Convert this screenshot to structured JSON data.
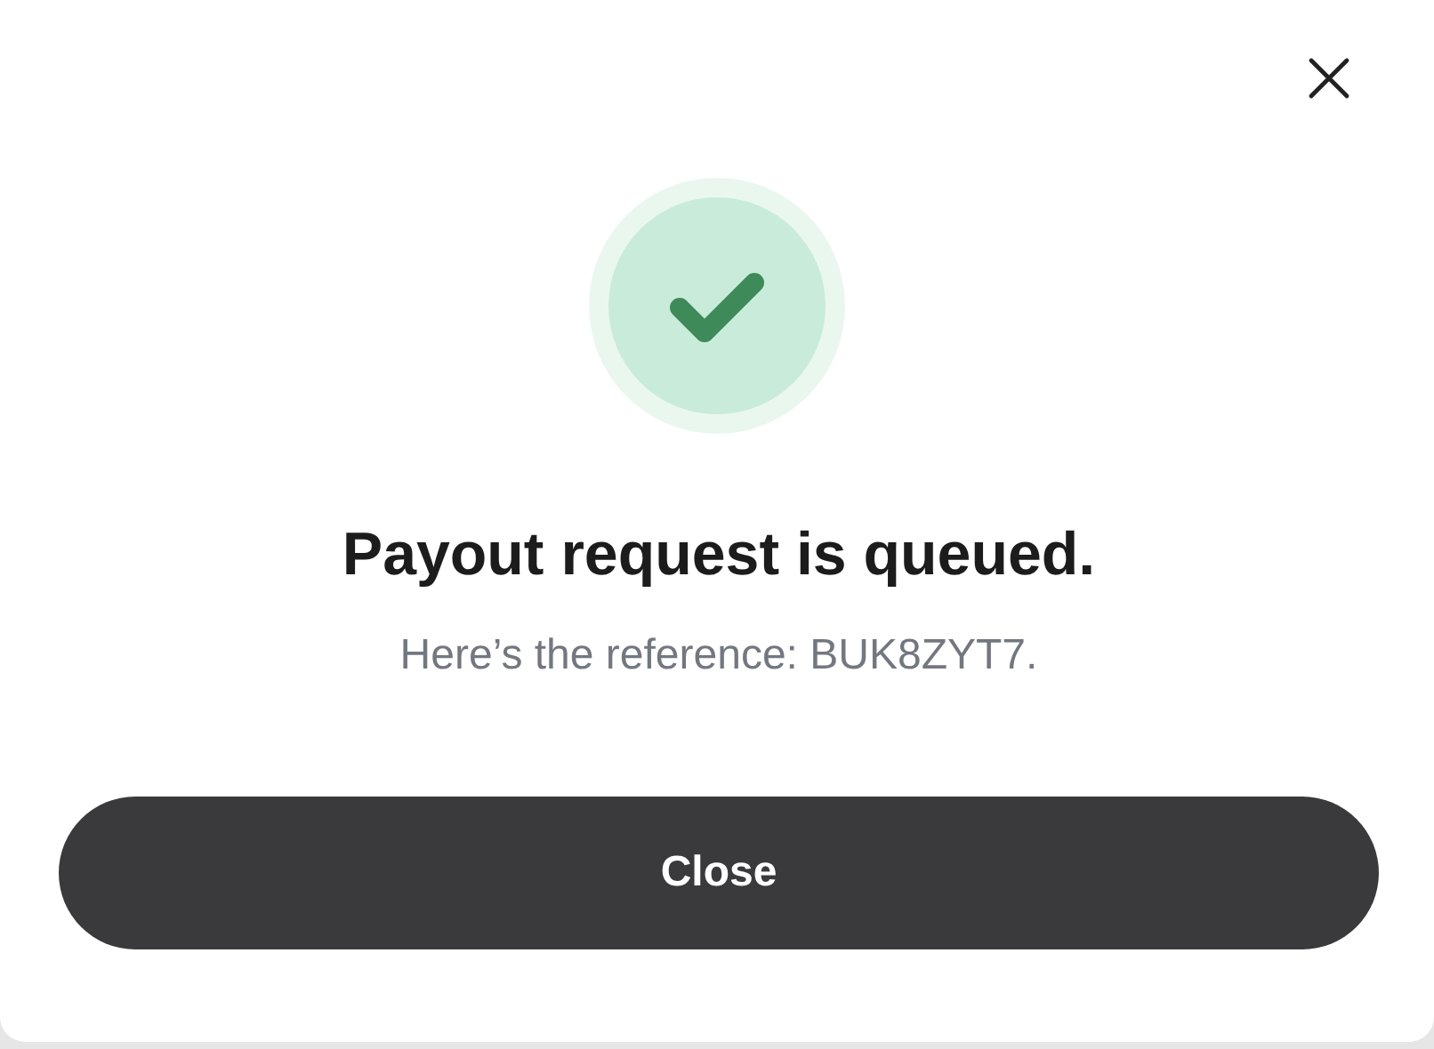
{
  "dialog": {
    "title": "Payout request is queued.",
    "message": "Here’s the reference: BUK8ZYT7.",
    "button": "Close"
  }
}
